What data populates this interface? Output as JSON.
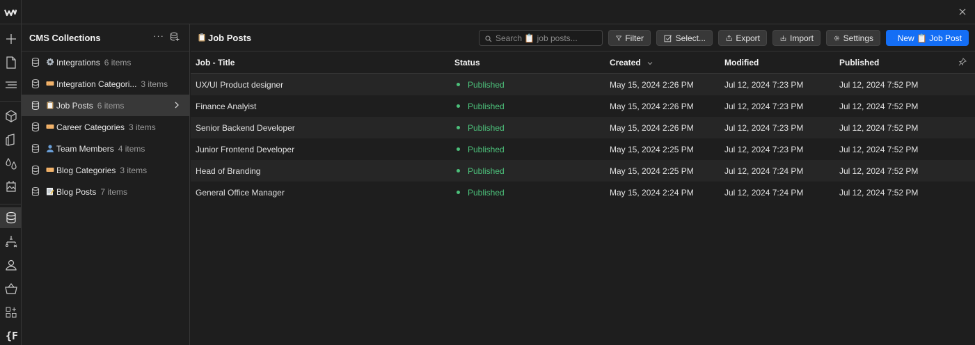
{
  "colors": {
    "accent": "#146ef5",
    "published": "#4cc07a"
  },
  "topbar": {
    "logo_icon": "webflow-logo-icon",
    "close_icon": "close-icon"
  },
  "rail": {
    "items": [
      {
        "icon": "plus-icon"
      },
      {
        "icon": "page-icon"
      },
      {
        "icon": "navigator-icon"
      },
      {
        "icon": "components-icon"
      },
      {
        "icon": "variables-icon"
      },
      {
        "icon": "styles-icon"
      },
      {
        "icon": "assets-icon"
      },
      {
        "icon": "cms-icon"
      },
      {
        "icon": "logic-icon"
      },
      {
        "icon": "users-icon"
      },
      {
        "icon": "ecommerce-icon"
      },
      {
        "icon": "apps-icon"
      },
      {
        "icon": "finsweet-icon"
      }
    ]
  },
  "panel": {
    "title": "CMS Collections",
    "more": "···",
    "collections": [
      {
        "emoji": "⚙️",
        "name": "Integrations",
        "count": "6 items",
        "active": false
      },
      {
        "emoji": "🎫",
        "name": "Integration Categori...",
        "count": "3 items",
        "active": false
      },
      {
        "emoji": "📋",
        "name": "Job Posts",
        "count": "6 items",
        "active": true
      },
      {
        "emoji": "🎫",
        "name": "Career Categories",
        "count": "3 items",
        "active": false
      },
      {
        "emoji": "👤",
        "name": "Team Members",
        "count": "4 items",
        "active": false
      },
      {
        "emoji": "🎫",
        "name": "Blog Categories",
        "count": "3 items",
        "active": false
      },
      {
        "emoji": "📝",
        "name": "Blog Posts",
        "count": "7 items",
        "active": false
      }
    ]
  },
  "main": {
    "title": "Job Posts",
    "title_emoji": "📋",
    "search_placeholder": "Search 📋 job posts...",
    "buttons": {
      "filter": "Filter",
      "select": "Select...",
      "export": "Export",
      "import": "Import",
      "settings": "Settings",
      "new": "New 📋 Job Post"
    },
    "columns": [
      "Job - Title",
      "Status",
      "Created",
      "Modified",
      "Published"
    ],
    "rows": [
      {
        "title": "UX/UI Product designer",
        "status": "Published",
        "created": "May 15, 2024 2:26 PM",
        "modified": "Jul 12, 2024 7:23 PM",
        "published": "Jul 12, 2024 7:52 PM"
      },
      {
        "title": "Finance Analyist",
        "status": "Published",
        "created": "May 15, 2024 2:26 PM",
        "modified": "Jul 12, 2024 7:23 PM",
        "published": "Jul 12, 2024 7:52 PM"
      },
      {
        "title": "Senior Backend Developer",
        "status": "Published",
        "created": "May 15, 2024 2:26 PM",
        "modified": "Jul 12, 2024 7:23 PM",
        "published": "Jul 12, 2024 7:52 PM"
      },
      {
        "title": "Junior Frontend Developer",
        "status": "Published",
        "created": "May 15, 2024 2:25 PM",
        "modified": "Jul 12, 2024 7:23 PM",
        "published": "Jul 12, 2024 7:52 PM"
      },
      {
        "title": "Head of Branding",
        "status": "Published",
        "created": "May 15, 2024 2:25 PM",
        "modified": "Jul 12, 2024 7:24 PM",
        "published": "Jul 12, 2024 7:52 PM"
      },
      {
        "title": "General Office Manager",
        "status": "Published",
        "created": "May 15, 2024 2:24 PM",
        "modified": "Jul 12, 2024 7:24 PM",
        "published": "Jul 12, 2024 7:52 PM"
      }
    ]
  }
}
